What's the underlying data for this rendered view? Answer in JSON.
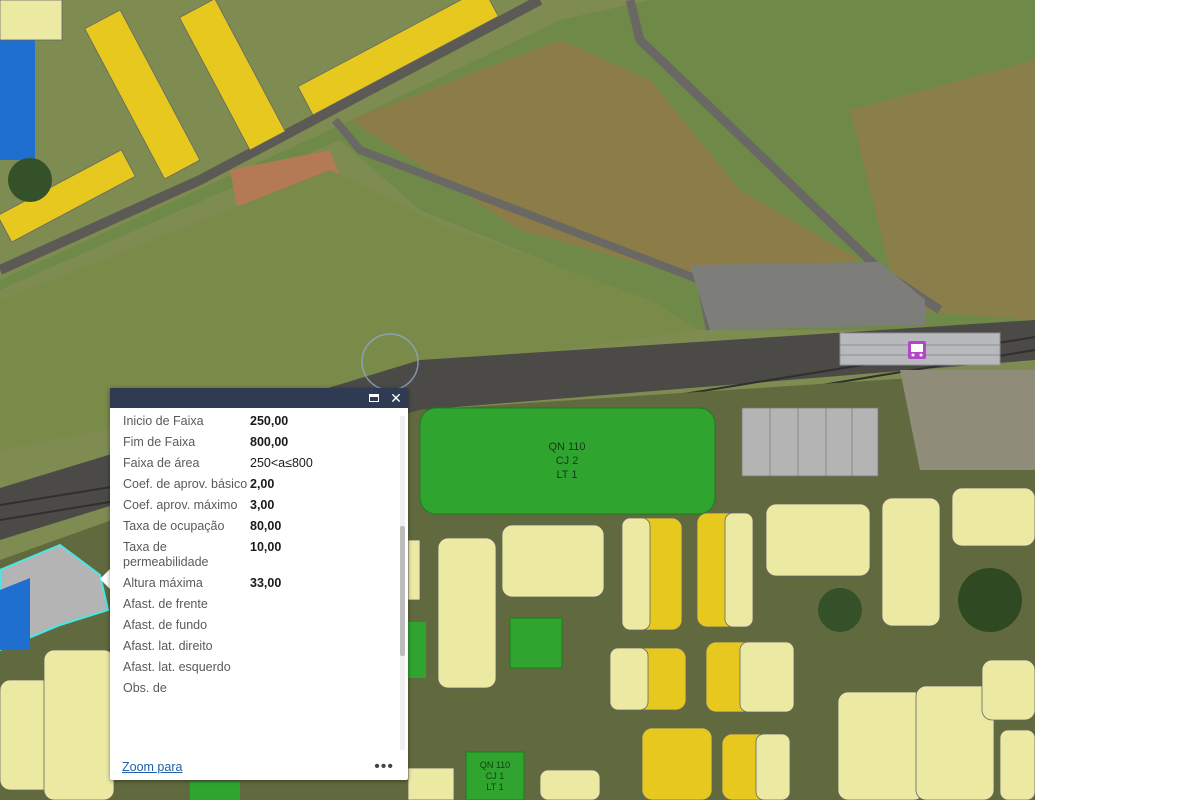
{
  "popup": {
    "rows": [
      {
        "label": "Inicio de Faixa",
        "value": "250,00"
      },
      {
        "label": "Fim de Faixa",
        "value": "800,00"
      },
      {
        "label": "Faixa de área",
        "value": "250<a≤800"
      },
      {
        "label": "Coef. de aprov. básico",
        "value": "2,00"
      },
      {
        "label": "Coef. aprov. máximo",
        "value": "3,00"
      },
      {
        "label": "Taxa de ocupação",
        "value": "80,00"
      },
      {
        "label": "Taxa de permeabilidade",
        "value": "10,00"
      },
      {
        "label": "Altura máxima",
        "value": "33,00"
      },
      {
        "label": "Afast. de frente",
        "value": ""
      },
      {
        "label": "Afast. de fundo",
        "value": ""
      },
      {
        "label": "Afast. lat. direito",
        "value": ""
      },
      {
        "label": "Afast. lat. esquerdo",
        "value": ""
      },
      {
        "label": "Obs. de",
        "value": ""
      }
    ],
    "zoom_label": "Zoom para",
    "more_label": "•••",
    "maximize_icon": "maximize-icon",
    "close_icon": "close-icon"
  },
  "map": {
    "parcel_label": [
      "QN 110",
      "CJ 2",
      "LT 1"
    ],
    "small_parcel_label": [
      "QN 110",
      "CJ 1",
      "LT 1"
    ],
    "station_icon": "bus-icon",
    "colors": {
      "highlight_green": "#2fa52f",
      "lot_yellow": "#e6c81e",
      "lot_pale": "#ece9a3",
      "lot_grey": "#b4b4b4",
      "roof_blue": "#1f6fd0",
      "selection_cyan": "#49e6e6",
      "station_marker": "#b446c8"
    }
  }
}
